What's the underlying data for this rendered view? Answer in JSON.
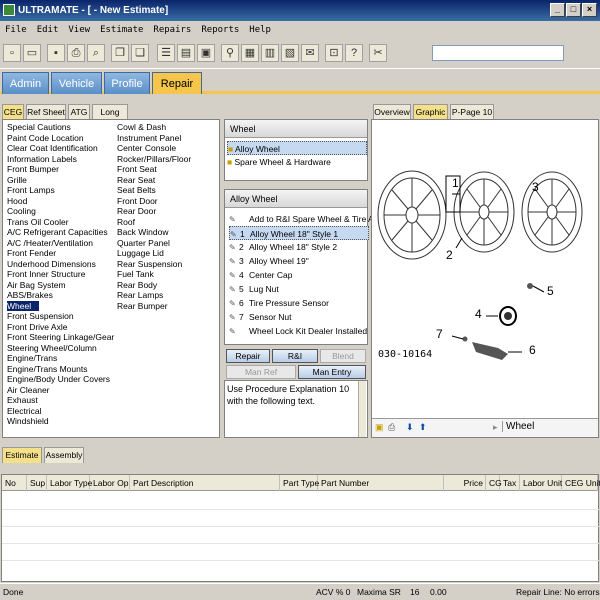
{
  "window": {
    "title": "ULTRAMATE - [ - New Estimate]",
    "min": "_",
    "max": "□",
    "close": "×"
  },
  "menu": [
    "File",
    "Edit",
    "View",
    "Estimate",
    "Repairs",
    "Reports",
    "Help"
  ],
  "main_tabs": [
    "Admin",
    "Vehicle",
    "Profile",
    "Repair"
  ],
  "left_tabs": [
    "CEG",
    "Ref Sheet",
    "ATG",
    "Long Exp"
  ],
  "ceg_col1": [
    "Special Cautions",
    "Paint Code Location",
    "Clear Coat Identification",
    "Information Labels",
    "Front Bumper",
    "Grille",
    "Front Lamps",
    "Hood",
    "Cooling",
    "Trans Oil Cooler",
    "A/C Refrigerant Capacities",
    "A/C /Heater/Ventilation",
    "Front Fender",
    "Underhood Dimensions",
    "Front Inner Structure",
    "Air Bag System",
    "ABS/Brakes",
    "Wheel",
    "Front Suspension",
    "Front Drive Axle",
    "Front Steering Linkage/Gear",
    "Steering Wheel/Column",
    "Engine/Trans",
    "Engine/Trans Mounts",
    "Engine/Body Under Covers",
    "Air Cleaner",
    "Exhaust",
    "Electrical",
    "Windshield"
  ],
  "ceg_col2": [
    "Cowl & Dash",
    "Instrument Panel",
    "Center Console",
    "Rocker/Pillars/Floor",
    "Front Seat",
    "Rear Seat",
    "Seat Belts",
    "Front Door",
    "Rear Door",
    "Roof",
    "Back Window",
    "Quarter Panel",
    "Luggage Lid",
    "Rear Suspension",
    "Fuel Tank",
    "Rear Body",
    "Rear Lamps",
    "Rear Bumper"
  ],
  "wheel_panel": {
    "header": "Wheel",
    "items": [
      "Alloy Wheel",
      "Spare Wheel & Hardware"
    ]
  },
  "alloy_panel": {
    "header": "Alloy Wheel",
    "items": [
      {
        "num": "",
        "label": "Add to R&I Spare Wheel & Tire A..."
      },
      {
        "num": "1",
        "label": "Alloy Wheel 18\" Style 1"
      },
      {
        "num": "2",
        "label": "Alloy Wheel 18\" Style 2"
      },
      {
        "num": "3",
        "label": "Alloy Wheel 19\""
      },
      {
        "num": "4",
        "label": "Center Cap"
      },
      {
        "num": "5",
        "label": "Lug Nut"
      },
      {
        "num": "6",
        "label": "Tire Pressure Sensor"
      },
      {
        "num": "7",
        "label": "Sensor Nut"
      },
      {
        "num": "",
        "label": "Wheel Lock Kit Dealer Installed"
      }
    ]
  },
  "action_buttons": {
    "repair": "Repair",
    "ri": "R&I",
    "blend": "Blend",
    "man_ref": "Man Ref",
    "man_entry": "Man Entry"
  },
  "procedure_text": "Use Procedure Explanation 10 with the following text.",
  "graphic_tabs": [
    "Overview",
    "Graphic",
    "P-Page 10"
  ],
  "diagram": {
    "code": "030-10164",
    "callouts": [
      "1",
      "2",
      "3",
      "4",
      "5",
      "6",
      "7"
    ],
    "footer_label": "Wheel",
    "footer_nav": "▸"
  },
  "bottom_tabs": [
    "Estimate",
    "Assembly"
  ],
  "estimate_columns": [
    "No",
    "Sup",
    "Labor Type",
    "Labor Op",
    "Part Description",
    "Part Type",
    "Part Number",
    "Price",
    "CG",
    "Tax",
    "Labor Unit",
    "CEG Unit"
  ],
  "status": {
    "left": "Done",
    "acv": "ACV % 0",
    "vehicle": "Maxima SR",
    "num": "16",
    "amount": "0.00",
    "repair_line": "Repair Line: No errors"
  },
  "colors": {
    "titlebar": "#0a246a",
    "tab_blue": "#5a8fc8",
    "tab_active": "#f5c64b",
    "selection": "#0a246a"
  }
}
